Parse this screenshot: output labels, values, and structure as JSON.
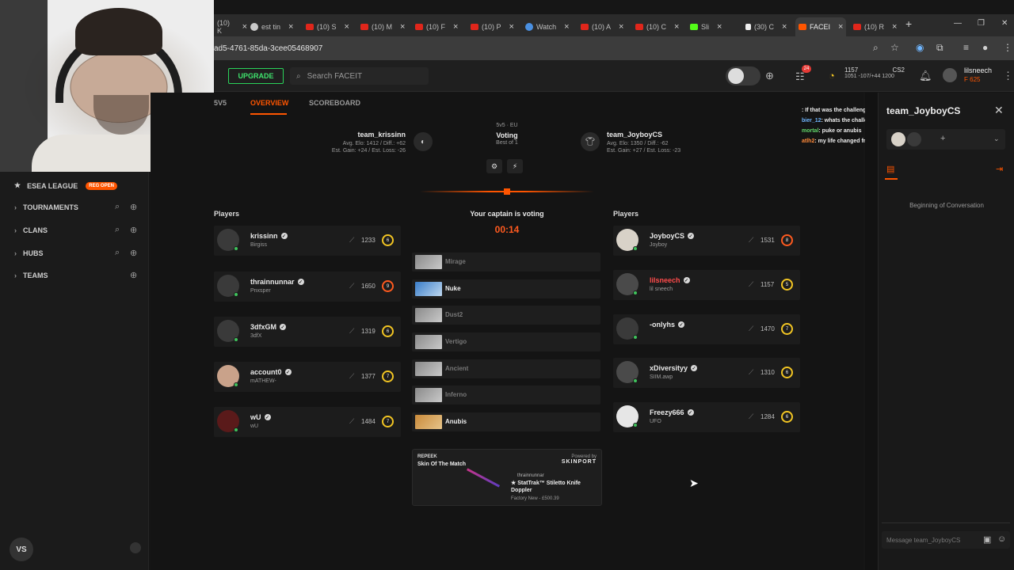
{
  "browser": {
    "tabs": [
      {
        "label": "(10) K",
        "icon": "youtube-icon"
      },
      {
        "label": "est tin",
        "icon": "globe-icon"
      },
      {
        "label": "(10) S",
        "icon": "youtube-icon"
      },
      {
        "label": "(10) M",
        "icon": "youtube-icon"
      },
      {
        "label": "(10) F",
        "icon": "youtube-icon"
      },
      {
        "label": "(10) P",
        "icon": "youtube-icon"
      },
      {
        "label": "Watch",
        "icon": "edge-icon"
      },
      {
        "label": "(10) A",
        "icon": "youtube-icon"
      },
      {
        "label": "(10) C",
        "icon": "youtube-icon"
      },
      {
        "label": "Sli",
        "icon": "kick-icon"
      },
      {
        "label": "(30) C",
        "icon": "tiktok-icon"
      },
      {
        "label": "FACEI",
        "icon": "faceit-icon"
      },
      {
        "label": "(10) R",
        "icon": "youtube-icon"
      }
    ],
    "url": "ad5-4761-85da-3cee05468907"
  },
  "header": {
    "upgrade": "UPGRADE",
    "search_placeholder": "Search FACEIT",
    "notifications": "24",
    "elo": "1157",
    "elo_range": "1051 -107/+44 1200",
    "game": "CS2",
    "username": "lilsneech",
    "points": "625"
  },
  "sidebar": {
    "league": "ESEA LEAGUE",
    "league_badge": "REG OPEN",
    "items": [
      "TOURNAMENTS",
      "CLANS",
      "HUBS",
      "TEAMS"
    ],
    "user_initials": "VS"
  },
  "match": {
    "tabs": [
      "5V5",
      "OVERVIEW",
      "SCOREBOARD"
    ],
    "active_tab": "OVERVIEW",
    "team1": {
      "name": "team_krissinn",
      "elo": "Avg. Elo: 1412 / Diff.: +62",
      "gain": "Est. Gain: +24 / Est. Loss: -26"
    },
    "team2": {
      "name": "team_JoyboyCS",
      "elo": "Avg. Elo: 1350 / Diff.: -62",
      "gain": "Est. Gain: +27 / Est. Loss: -23"
    },
    "format": "5v5 · EU",
    "status": "Voting",
    "best_of": "Best of 1",
    "players_label": "Players",
    "captain_text": "Your captain is voting",
    "timer": "00:14",
    "team1_players": [
      {
        "nick": "krissinn",
        "sub": "Birgiss",
        "elo": "1233",
        "level": "6"
      },
      {
        "nick": "thrainnunnar",
        "sub": "Pnxsper",
        "elo": "1650",
        "level": "9"
      },
      {
        "nick": "3dfxGM",
        "sub": "3dfX",
        "elo": "1319",
        "level": "6"
      },
      {
        "nick": "account0",
        "sub": "mATHEW-",
        "elo": "1377",
        "level": "7"
      },
      {
        "nick": "wU",
        "sub": "wU",
        "elo": "1484",
        "level": "7"
      }
    ],
    "team2_players": [
      {
        "nick": "JoyboyCS",
        "sub": "Joyboy",
        "elo": "1531",
        "level": "8"
      },
      {
        "nick": "lilsneech",
        "sub": "lil sneech",
        "elo": "1157",
        "level": "5"
      },
      {
        "nick": "-onlyhs",
        "sub": "",
        "elo": "1470",
        "level": "7"
      },
      {
        "nick": "xDiversityy",
        "sub": "SIIM.awp",
        "elo": "1310",
        "level": "6"
      },
      {
        "nick": "Freezy666",
        "sub": "UFO",
        "elo": "1284",
        "level": "6"
      }
    ],
    "maps": [
      {
        "name": "Mirage",
        "on": false
      },
      {
        "name": "Nuke",
        "on": true
      },
      {
        "name": "Dust2",
        "on": false
      },
      {
        "name": "Vertigo",
        "on": false
      },
      {
        "name": "Ancient",
        "on": false
      },
      {
        "name": "Inferno",
        "on": false
      },
      {
        "name": "Anubis",
        "on": true
      }
    ],
    "ad": {
      "brand": "REPEEK",
      "title": "Skin Of The Match",
      "powered": "Powered by",
      "sponsor": "SKINPORT",
      "owner": "thrainnunnar",
      "skin": "★ StatTrak™ Stiletto Knife Doppler",
      "condition": "Factory New - £500.39"
    }
  },
  "overlay_chat": [
    {
      "user": "",
      "msg": ": If that was the challenge then I'd be frustrated",
      "color": "u1"
    },
    {
      "user": "bier_12",
      "msg": ": whats the challenge",
      "color": "u2"
    },
    {
      "user": "mortal",
      "msg": ": puke or anubis",
      "color": "u3"
    },
    {
      "user": "atlh2",
      "msg": ": my life changed from that video",
      "color": "u4"
    }
  ],
  "chat_panel": {
    "title": "team_JoyboyCS",
    "beginning": "Beginning of Conversation",
    "placeholder": "Message team_JoyboyCS"
  }
}
